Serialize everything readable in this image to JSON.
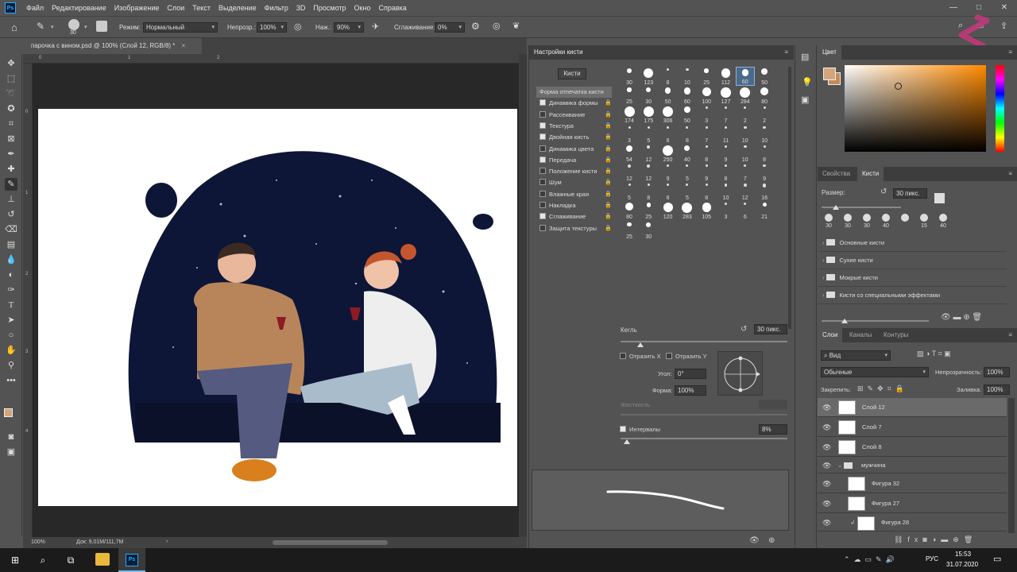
{
  "menu": {
    "app_icon": "Ps",
    "items": [
      "Файл",
      "Редактирование",
      "Изображение",
      "Слои",
      "Текст",
      "Выделение",
      "Фильтр",
      "3D",
      "Просмотр",
      "Окно",
      "Справка"
    ]
  },
  "window_controls": [
    "minimize-icon",
    "maximize-icon",
    "close-icon"
  ],
  "options": {
    "brush_size": "30",
    "mode_label": "Режим:",
    "mode_value": "Нормальный",
    "opacity_label": "Непрозр.:",
    "opacity_value": "100%",
    "flow_label": "Наж.:",
    "flow_value": "90%",
    "smoothing_label": "Сглаживание:",
    "smoothing_value": "0%",
    "angle": "0°"
  },
  "document": {
    "tab_title": "парочка с вином.psd @ 100% (Слой 12, RGB/8) *",
    "zoom": "100%",
    "doc_info": "Док: 9,01M/111,7M",
    "ruler_top": [
      "0",
      "1",
      "2"
    ],
    "ruler_left": [
      "0",
      "1",
      "2",
      "3",
      "4"
    ]
  },
  "brush_settings": {
    "title": "Настройки кисти",
    "brushes_button": "Кисти",
    "items": [
      {
        "label": "Форма отпечатка кисти",
        "checked": null,
        "lock": false,
        "selected": true
      },
      {
        "label": "Динамика формы",
        "checked": true,
        "lock": true
      },
      {
        "label": "Рассеивание",
        "checked": false,
        "lock": true
      },
      {
        "label": "Текстура",
        "checked": true,
        "lock": true
      },
      {
        "label": "Двойная кисть",
        "checked": true,
        "lock": true
      },
      {
        "label": "Динамика цвета",
        "checked": false,
        "lock": true
      },
      {
        "label": "Передача",
        "checked": true,
        "lock": true
      },
      {
        "label": "Положение кисти",
        "checked": false,
        "lock": true
      },
      {
        "label": "Шум",
        "checked": false,
        "lock": true
      },
      {
        "label": "Влажные края",
        "checked": false,
        "lock": true
      },
      {
        "label": "Накладка",
        "checked": false,
        "lock": true
      },
      {
        "label": "Сглаживание",
        "checked": true,
        "lock": true
      },
      {
        "label": "Защита текстуры",
        "checked": false,
        "lock": true
      }
    ],
    "tip_sizes": [
      [
        "30",
        "123",
        "8",
        "10",
        "25",
        "112",
        "60",
        "50"
      ],
      [
        "25",
        "30",
        "50",
        "60",
        "100",
        "127",
        "284",
        "80"
      ],
      [
        "174",
        "175",
        "306",
        "50",
        "3",
        "7",
        "2",
        "2"
      ],
      [
        "3",
        "5",
        "6",
        "8",
        "7",
        "11",
        "10",
        "10"
      ],
      [
        "54",
        "12",
        "250",
        "40",
        "8",
        "9",
        "10",
        "8"
      ],
      [
        "12",
        "12",
        "9",
        "5",
        "9",
        "8",
        "7",
        "9"
      ],
      [
        "5",
        "8",
        "6",
        "5",
        "8",
        "10",
        "12",
        "16"
      ],
      [
        "80",
        "25",
        "120",
        "283",
        "105",
        "3",
        "6",
        "21"
      ],
      [
        "25",
        "30"
      ]
    ],
    "size_label": "Кегль",
    "size_value": "30 пикс.",
    "flip_x_label": "Отразить X",
    "flip_y_label": "Отразить Y",
    "angle_label": "Угол:",
    "angle_value": "0°",
    "roundness_label": "Форма:",
    "roundness_value": "100%",
    "hardness_label": "Жесткость",
    "spacing_label": "Интервалы",
    "spacing_value": "8%",
    "spacing_checked": true,
    "size_level": 0.12,
    "spacing_level": 0.04
  },
  "color_panel": {
    "title": "Цвет",
    "foreground": "#d4a57a",
    "background": "#c48a5b",
    "hue_base": "#ff8a00"
  },
  "brushes_panel": {
    "tabs": [
      "Свойства",
      "Кисти"
    ],
    "size_label": "Размер:",
    "size_value": "30 пикс.",
    "recent_sizes": [
      "30",
      "30",
      "30",
      "40",
      "",
      "15",
      "40"
    ],
    "folders": [
      "Основные кисти",
      "Сухие кисти",
      "Мокрые кисти",
      "Кисти со специальными эффектами"
    ]
  },
  "layers_panel": {
    "tabs": [
      "Слои",
      "Каналы",
      "Контуры"
    ],
    "filter_label": "Вид",
    "blend_mode": "Обычные",
    "opacity_label": "Непрозрачность:",
    "opacity_value": "100%",
    "lock_label": "Закрепить:",
    "fill_label": "Заливка:",
    "fill_value": "100%",
    "layers": [
      {
        "name": "Слой 12",
        "type": "layer",
        "selected": true
      },
      {
        "name": "Слой 7",
        "type": "layer"
      },
      {
        "name": "Слой 8",
        "type": "layer"
      },
      {
        "name": "мужчина",
        "type": "group"
      },
      {
        "name": "Фигура 32",
        "type": "shape"
      },
      {
        "name": "Фигура 27",
        "type": "shape"
      },
      {
        "name": "Фигура 28",
        "type": "shape"
      }
    ]
  },
  "taskbar": {
    "lang": "РУС",
    "time": "15:53",
    "date": "31.07.2020"
  }
}
